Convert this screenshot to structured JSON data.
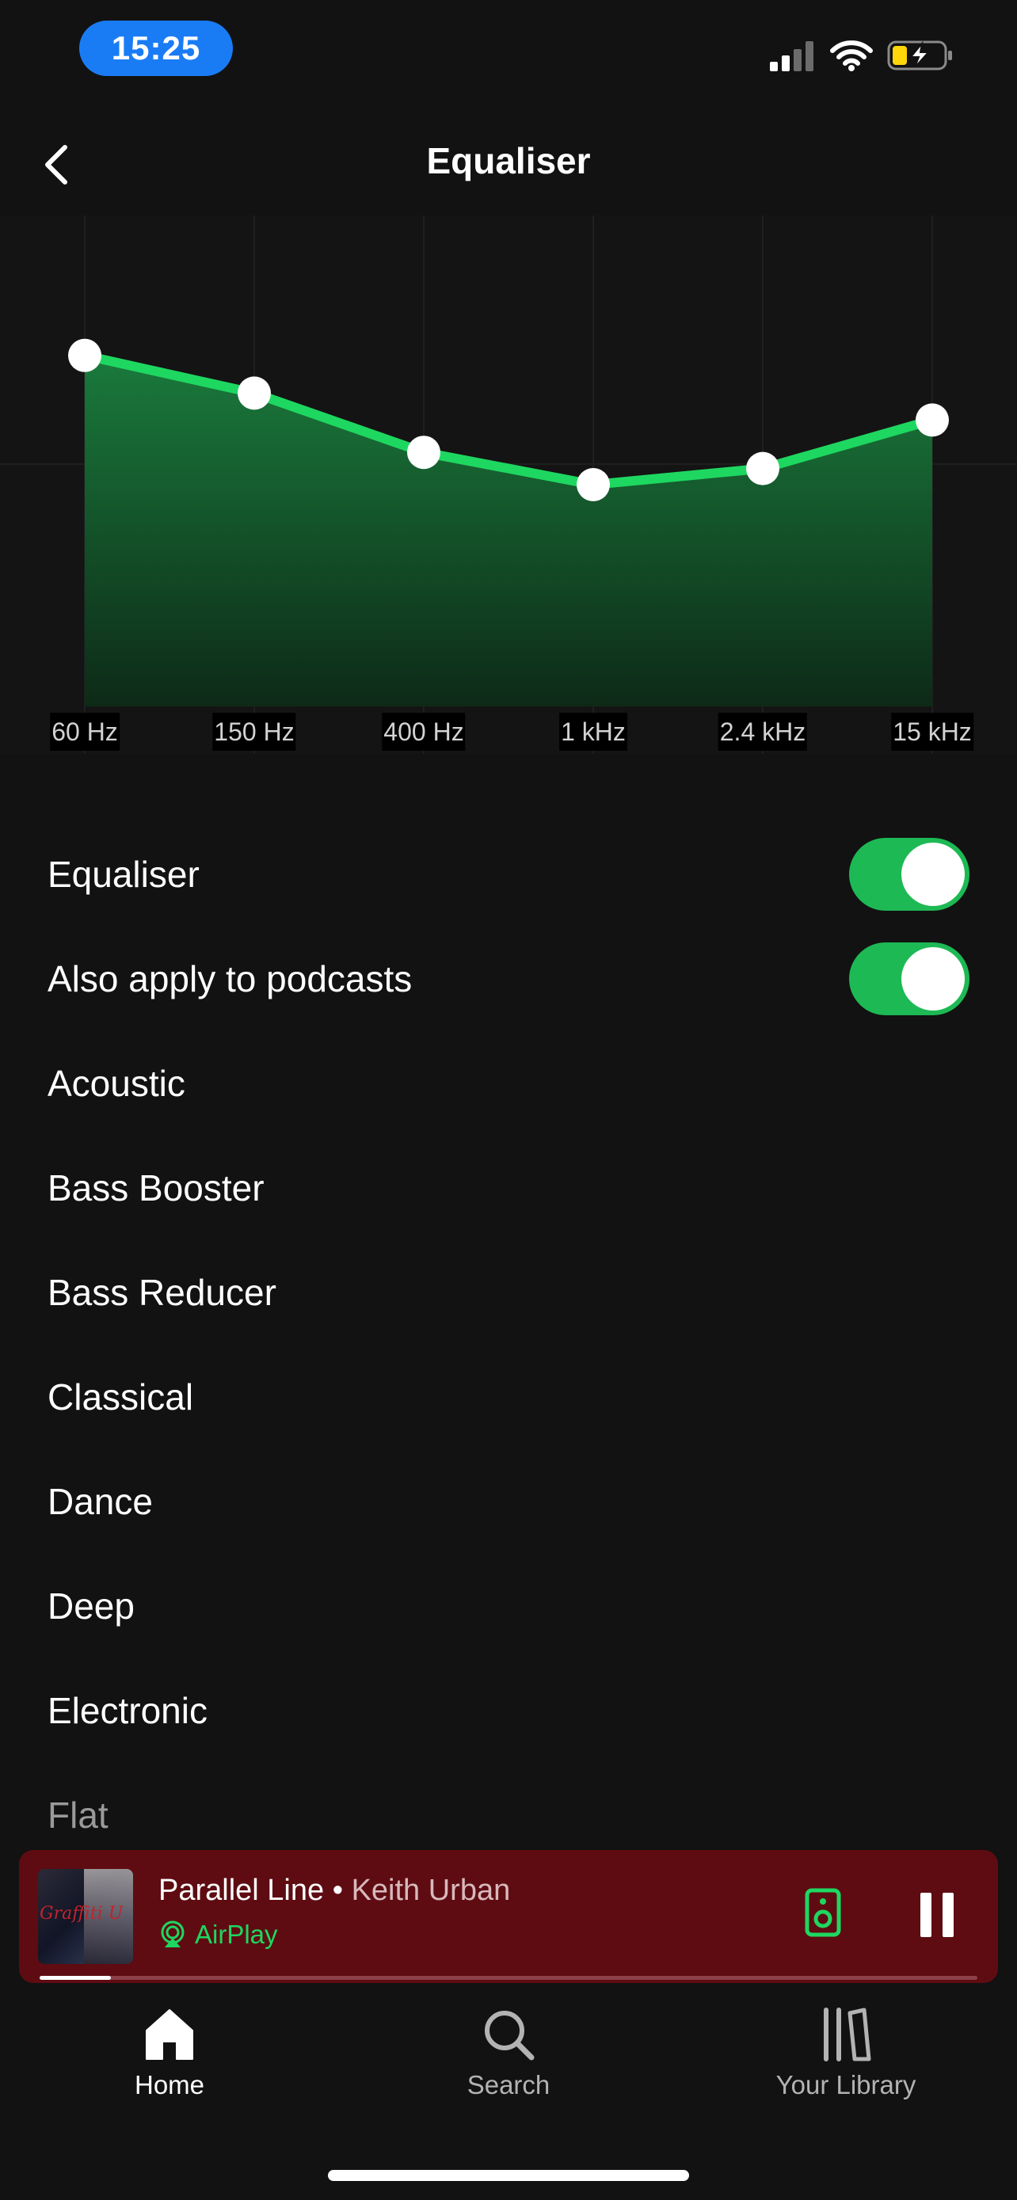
{
  "status_bar": {
    "time": "15:25"
  },
  "header": {
    "title": "Equaliser",
    "back_icon": "chevron-left-icon"
  },
  "equalizer": {
    "accent_color": "#1ed760",
    "bands": [
      {
        "label": "60 Hz",
        "level": 0.74
      },
      {
        "label": "150 Hz",
        "level": 0.67
      },
      {
        "label": "400 Hz",
        "level": 0.56
      },
      {
        "label": "1 kHz",
        "level": 0.5
      },
      {
        "label": "2.4 kHz",
        "level": 0.53
      },
      {
        "label": "15 kHz",
        "level": 0.62
      }
    ]
  },
  "settings": {
    "equaliser": {
      "label": "Equaliser",
      "enabled": true
    },
    "podcasts": {
      "label": "Also apply to podcasts",
      "enabled": true
    }
  },
  "presets": [
    "Acoustic",
    "Bass Booster",
    "Bass Reducer",
    "Classical",
    "Dance",
    "Deep",
    "Electronic",
    "Flat"
  ],
  "now_playing": {
    "title": "Parallel Line",
    "separator": " • ",
    "artist": "Keith Urban",
    "output": "AirPlay",
    "album_art_text": "Graffiti U",
    "progress": 0.076,
    "background": "#5e0c12",
    "accent": "#1ed760"
  },
  "tab_bar": {
    "home": {
      "label": "Home",
      "icon": "home-icon"
    },
    "search": {
      "label": "Search",
      "icon": "search-icon"
    },
    "library": {
      "label": "Your Library",
      "icon": "library-icon"
    }
  }
}
